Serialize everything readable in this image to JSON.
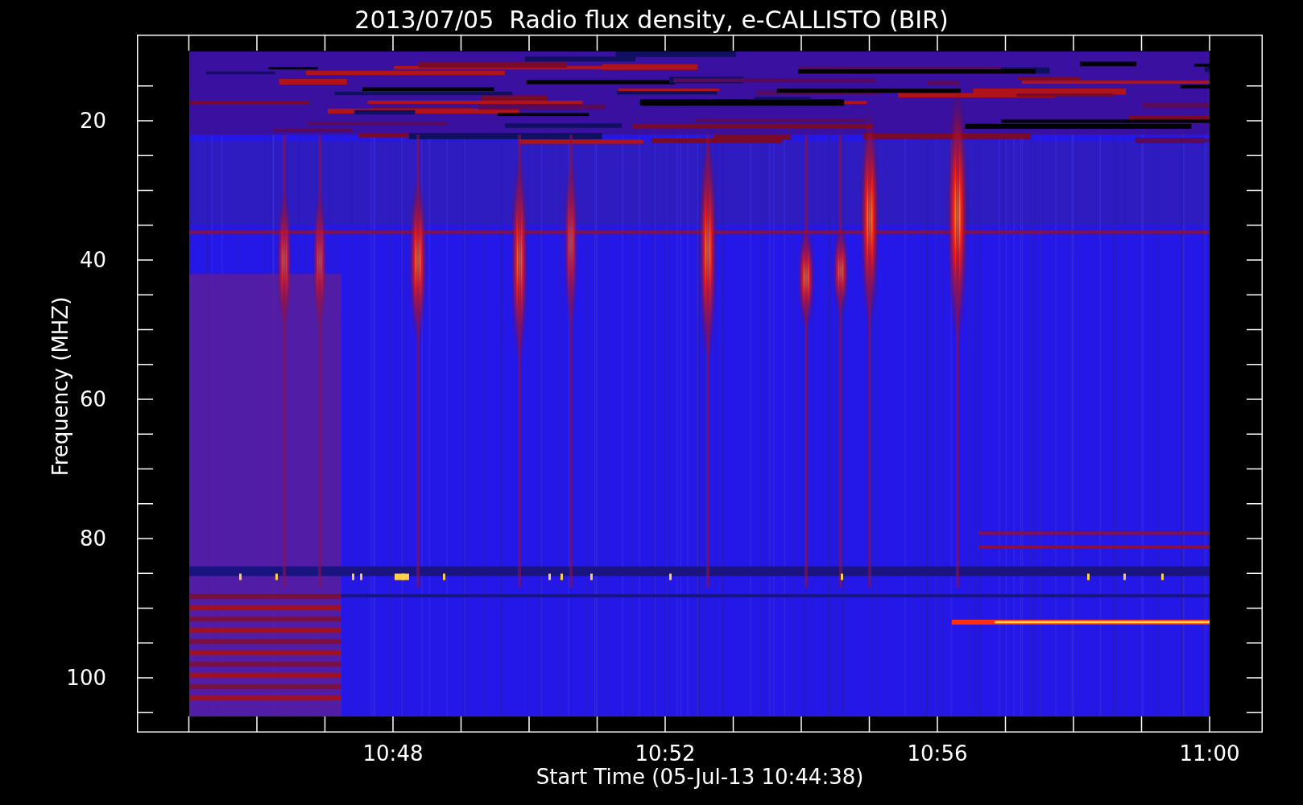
{
  "title": "2013/07/05  Radio flux density, e-CALLISTO (BIR)",
  "y_axis": {
    "label": "Frequency (MHZ)",
    "ticks": [
      "20",
      "40",
      "60",
      "80",
      "100"
    ]
  },
  "x_axis": {
    "label": "Start Time (05-Jul-13 10:44:38)",
    "ticks": [
      "10:48",
      "10:52",
      "10:56",
      "11:00"
    ]
  }
}
